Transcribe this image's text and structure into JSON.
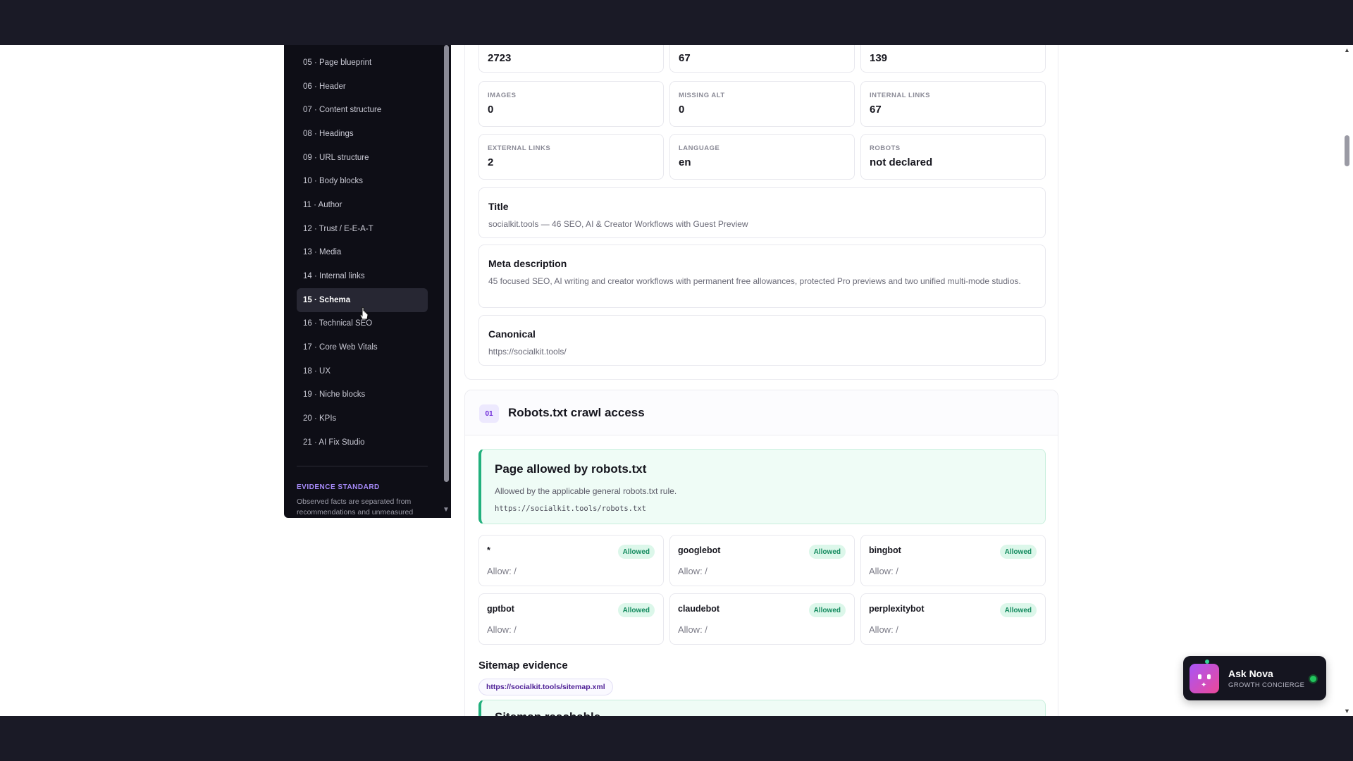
{
  "sidebar": {
    "items": [
      {
        "label": "05 · Page blueprint"
      },
      {
        "label": "06 · Header"
      },
      {
        "label": "07 · Content structure"
      },
      {
        "label": "08 · Headings"
      },
      {
        "label": "09 · URL structure"
      },
      {
        "label": "10 · Body blocks"
      },
      {
        "label": "11 · Author"
      },
      {
        "label": "12 · Trust / E-E-A-T"
      },
      {
        "label": "13 · Media"
      },
      {
        "label": "14 · Internal links"
      },
      {
        "label": "15 · Schema"
      },
      {
        "label": "16 · Technical SEO"
      },
      {
        "label": "17 · Core Web Vitals"
      },
      {
        "label": "18 · UX"
      },
      {
        "label": "19 · Niche blocks"
      },
      {
        "label": "20 · KPIs"
      },
      {
        "label": "21 · AI Fix Studio"
      }
    ],
    "active_index": 10,
    "evidence_title": "EVIDENCE STANDARD",
    "evidence_text": "Observed facts are separated from recommendations and unmeasured"
  },
  "metrics_top": [
    "2723",
    "67",
    "139"
  ],
  "metrics": [
    {
      "label": "IMAGES",
      "value": "0"
    },
    {
      "label": "MISSING ALT",
      "value": "0"
    },
    {
      "label": "INTERNAL LINKS",
      "value": "67"
    },
    {
      "label": "EXTERNAL LINKS",
      "value": "2"
    },
    {
      "label": "LANGUAGE",
      "value": "en"
    },
    {
      "label": "ROBOTS",
      "value": "not declared"
    }
  ],
  "title_card": {
    "heading": "Title",
    "text": "socialkit.tools — 46 SEO, AI & Creator Workflows with Guest Preview"
  },
  "meta_card": {
    "heading": "Meta description",
    "text": "45 focused SEO, AI writing and creator workflows with permanent free allowances, protected Pro previews and two unified multi-mode studios."
  },
  "canonical_card": {
    "heading": "Canonical",
    "text": "https://socialkit.tools/"
  },
  "robots_section": {
    "number": "01",
    "title": "Robots.txt crawl access",
    "status_title": "Page allowed by robots.txt",
    "status_text": "Allowed by the applicable general robots.txt rule.",
    "status_url": "https://socialkit.tools/robots.txt",
    "bots": [
      {
        "name": "*",
        "rule": "Allow: /",
        "badge": "Allowed"
      },
      {
        "name": "googlebot",
        "rule": "Allow: /",
        "badge": "Allowed"
      },
      {
        "name": "bingbot",
        "rule": "Allow: /",
        "badge": "Allowed"
      },
      {
        "name": "gptbot",
        "rule": "Allow: /",
        "badge": "Allowed"
      },
      {
        "name": "claudebot",
        "rule": "Allow: /",
        "badge": "Allowed"
      },
      {
        "name": "perplexitybot",
        "rule": "Allow: /",
        "badge": "Allowed"
      }
    ]
  },
  "sitemap": {
    "title": "Sitemap evidence",
    "link": "https://socialkit.tools/sitemap.xml",
    "box_title": "Sitemap reachable"
  },
  "nova": {
    "name": "Ask Nova",
    "role": "GROWTH CONCIERGE"
  },
  "colors": {
    "accent": "#a78bfa",
    "success": "#22b07d",
    "sidebar_bg": "#0e0e16"
  }
}
